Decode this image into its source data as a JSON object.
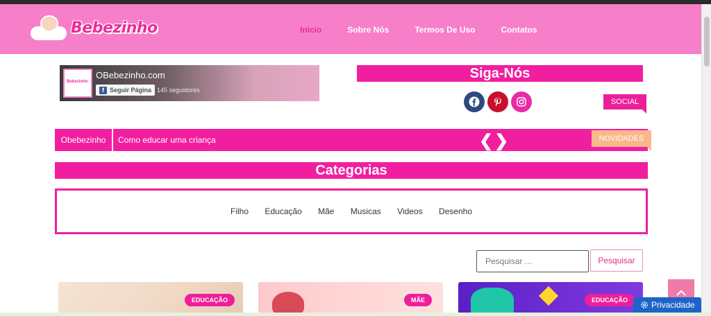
{
  "brand": {
    "logo_text": "Bebezinho",
    "logo_mini": "Bebezinho"
  },
  "nav": {
    "items": [
      {
        "label": "Inicio",
        "active": true
      },
      {
        "label": "Sobre Nós",
        "active": false
      },
      {
        "label": "Termos De Uso",
        "active": false
      },
      {
        "label": "Contatos",
        "active": false
      }
    ]
  },
  "facebook": {
    "page_name": "OBebezinho.com",
    "follow_label": "Seguir Página",
    "followers": "145 seguidores"
  },
  "social": {
    "title": "Siga-Nós",
    "tag": "SOCIAL",
    "icons": [
      "facebook-icon",
      "pinterest-icon",
      "instagram-icon"
    ]
  },
  "ticker": {
    "label": "Obebezinho",
    "headline": "Como educar uma criança",
    "tag": "NOVIDADES"
  },
  "categories": {
    "title": "Categorias",
    "links": [
      "Filho",
      "Educação",
      "Mãe",
      "Musicas",
      "Videos",
      "Desenho"
    ]
  },
  "search": {
    "placeholder": "Pesquisar ...",
    "button_label": "Pesquisar"
  },
  "cards": [
    {
      "badge": "EDUCAÇÃO"
    },
    {
      "badge": "MÃE"
    },
    {
      "badge": "EDUCAÇÃO"
    }
  ],
  "privacy": {
    "label": "Privacidade"
  },
  "colors": {
    "header": "#f77fc9",
    "accent": "#f21ea0",
    "novidades": "#f9b88a"
  }
}
